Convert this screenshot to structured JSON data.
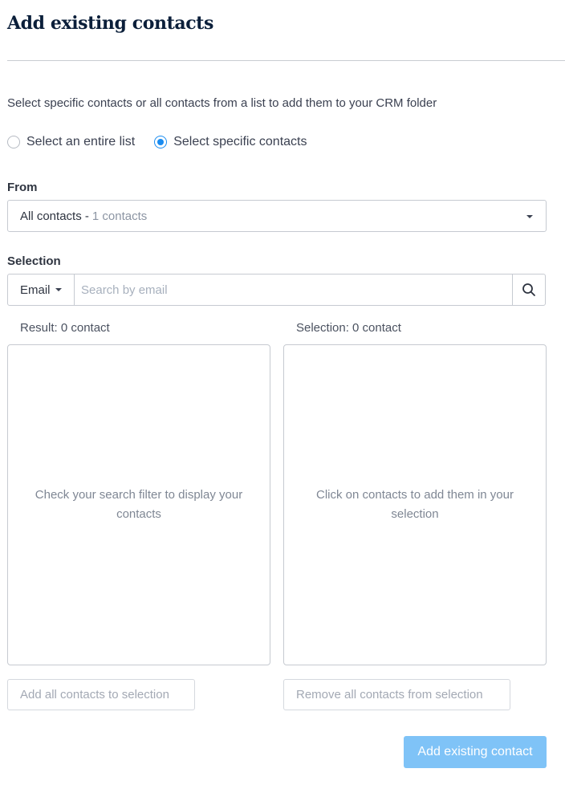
{
  "header": {
    "title": "Add existing contacts"
  },
  "intro": "Select specific contacts or all contacts from a list to add them to your CRM folder",
  "mode": {
    "options": [
      {
        "label": "Select an entire list",
        "checked": false
      },
      {
        "label": "Select specific contacts",
        "checked": true
      }
    ]
  },
  "from": {
    "label": "From",
    "selected_list": "All contacts -",
    "selected_count": "1 contacts"
  },
  "selection": {
    "label": "Selection",
    "filter_type": "Email",
    "search_placeholder": "Search by email",
    "search_value": ""
  },
  "result": {
    "header": "Result: 0 contact",
    "empty_text": "Check your search filter to display your contacts",
    "add_all_label": "Add all contacts to selection"
  },
  "selected": {
    "header": "Selection: 0 contact",
    "empty_text": "Click on contacts to add them in your selection",
    "remove_all_label": "Remove all contacts from selection"
  },
  "footer": {
    "submit_label": "Add existing contact"
  },
  "colors": {
    "accent": "#1a8cf0",
    "primary_disabled": "#7fc3f7",
    "title": "#0b1f3a"
  }
}
